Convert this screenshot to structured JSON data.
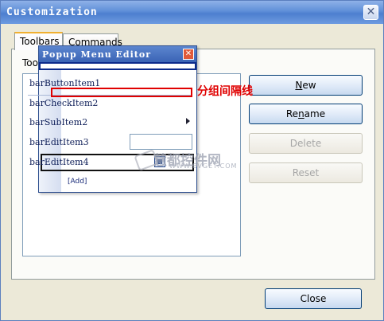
{
  "window": {
    "title": "Customization",
    "close_glyph": "✕"
  },
  "tabs": [
    {
      "label": "Toolbars",
      "active": true
    },
    {
      "label": "Commands",
      "active": false
    }
  ],
  "panel": {
    "label": "Too"
  },
  "buttons": {
    "new": {
      "accel": "N",
      "rest": "ew",
      "enabled": true
    },
    "rename": {
      "pre": "Re",
      "accel": "n",
      "rest": "ame",
      "enabled": true
    },
    "delete": {
      "label": "Delete",
      "enabled": false
    },
    "reset": {
      "label": "Reset",
      "enabled": false
    },
    "close": {
      "label": "Close",
      "enabled": true
    }
  },
  "popup_editor": {
    "title": "Popup Menu Editor",
    "close_glyph": "✕",
    "items": [
      {
        "label": "barButtonItem1"
      },
      {
        "label": "barCheckItem2"
      },
      {
        "label": "barSubItem2",
        "has_submenu": true
      },
      {
        "label": "barEditItem3",
        "has_editor": true
      },
      {
        "label": "barEditItem4",
        "icon": "check-icon"
      }
    ],
    "add_label": "[Add]"
  },
  "annotation": {
    "text": "分组间隔线",
    "color": "#e00000"
  },
  "watermark": {
    "text": "慧都控件网",
    "subtext": "WWW.EVGET.COM"
  },
  "colors": {
    "titlebar": "#4d7fcf",
    "dialog_bg": "#ece9d8",
    "popup_title": "#3a63b5"
  }
}
